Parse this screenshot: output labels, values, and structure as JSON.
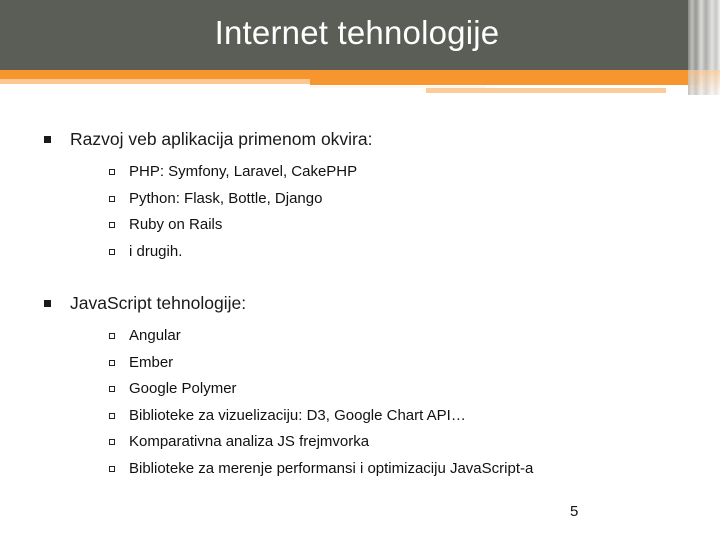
{
  "slide": {
    "title": "Internet tehnologije",
    "page_number": "5",
    "colors": {
      "header_bg": "#5a5e57",
      "accent_orange": "#f7962f",
      "accent_orange_light": "#fbc894",
      "title_text": "#ffffff",
      "body_text": "#111111"
    }
  },
  "sections": [
    {
      "heading": "Razvoj veb aplikacija primenom okvira:",
      "items": [
        "PHP: Symfony, Laravel, CakePHP",
        "Python: Flask, Bottle, Django",
        "Ruby on Rails",
        "i drugih."
      ]
    },
    {
      "heading": "JavaScript tehnologije:",
      "items": [
        "Angular",
        "Ember",
        "Google Polymer",
        "Biblioteke za vizuelizaciju: D3, Google Chart API…",
        "Komparativna analiza JS frejmvorka",
        "Biblioteke za merenje performansi i optimizaciju JavaScript-a"
      ]
    }
  ]
}
